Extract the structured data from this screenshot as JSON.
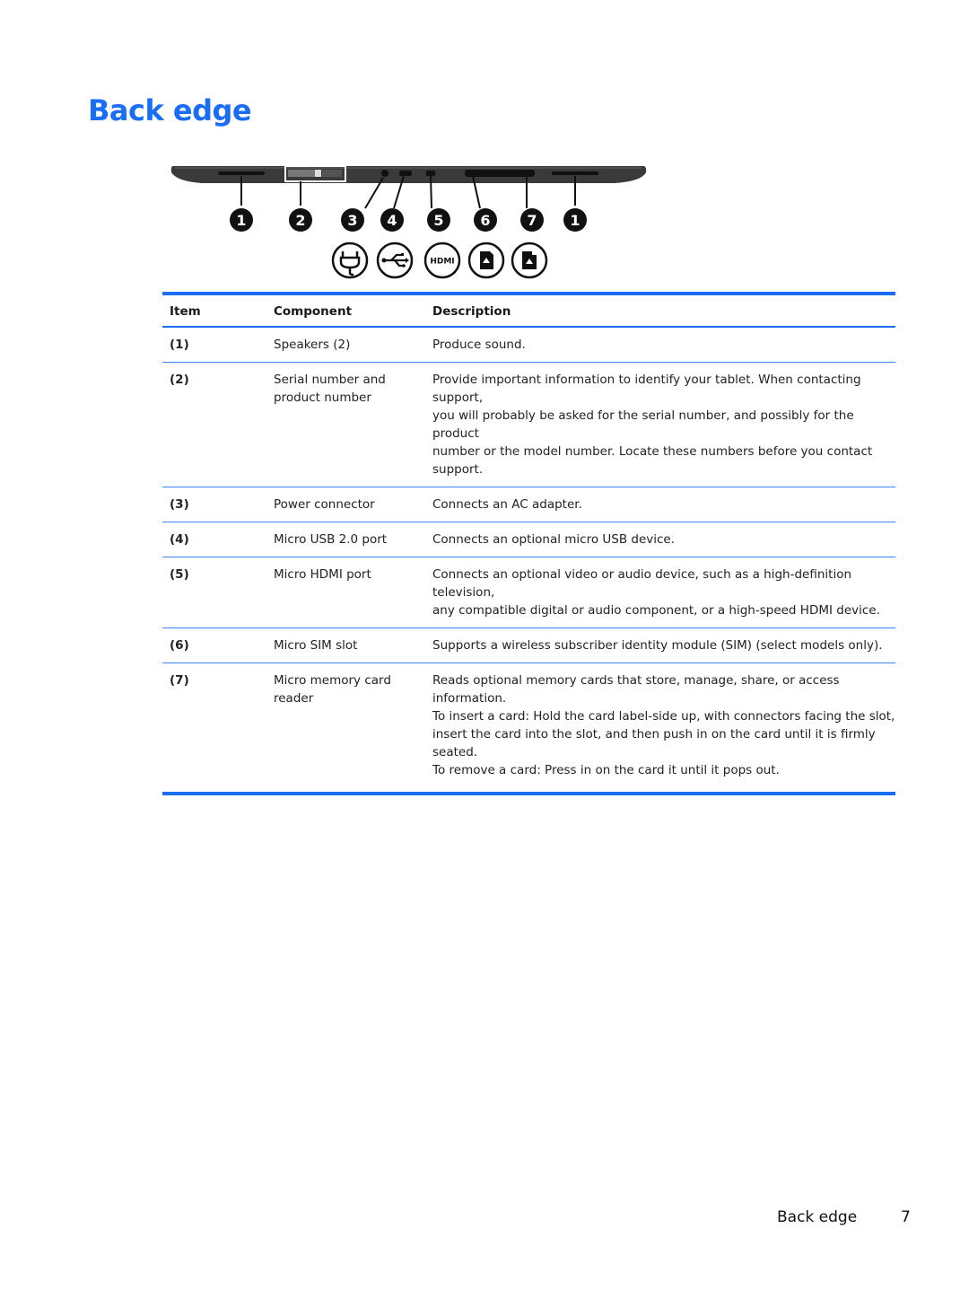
{
  "page": {
    "title": "Back edge",
    "title_color": "#1a6ef5"
  },
  "figure": {
    "callouts": [
      "1",
      "2",
      "3",
      "4",
      "5",
      "6",
      "7",
      "1"
    ],
    "icons": [
      "power-plug-icon",
      "usb-icon",
      "hdmi-icon",
      "sim-card-icon",
      "memory-card-icon"
    ],
    "hdmi_label": "HDMI"
  },
  "table": {
    "headers": {
      "item": "Item",
      "component": "Component",
      "description": "Description"
    },
    "rows": [
      {
        "item": "(1)",
        "component": "Speakers (2)",
        "description": "Produce sound."
      },
      {
        "item": "(2)",
        "component": "Serial number and\nproduct number",
        "description": "Provide important information to identify your tablet. When contacting support,\nyou will probably be asked for the serial number, and possibly for the product\nnumber or the model number. Locate these numbers before you contact support."
      },
      {
        "item": "(3)",
        "component": "Power connector",
        "description": "Connects an AC adapter."
      },
      {
        "item": "(4)",
        "component": "Micro USB 2.0 port",
        "description": "Connects an optional micro USB device."
      },
      {
        "item": "(5)",
        "component": "Micro HDMI port",
        "description": "Connects an optional video or audio device, such as a high-definition television,\nany compatible digital or audio component, or a high-speed HDMI device."
      },
      {
        "item": "(6)",
        "component": "Micro SIM slot",
        "description": "Supports a wireless subscriber identity module (SIM) (select models only)."
      },
      {
        "item": "(7)",
        "component": "Micro memory card\nreader",
        "description": "Reads optional memory cards that store, manage, share, or access information.\nTo insert a card: Hold the card label-side up, with connectors facing the slot,\ninsert the card into the slot, and then push in on the card until it is firmly seated.\nTo remove a card: Press in on the card it until it pops out."
      }
    ]
  },
  "footer": {
    "section": "Back edge",
    "page_number": "7"
  }
}
